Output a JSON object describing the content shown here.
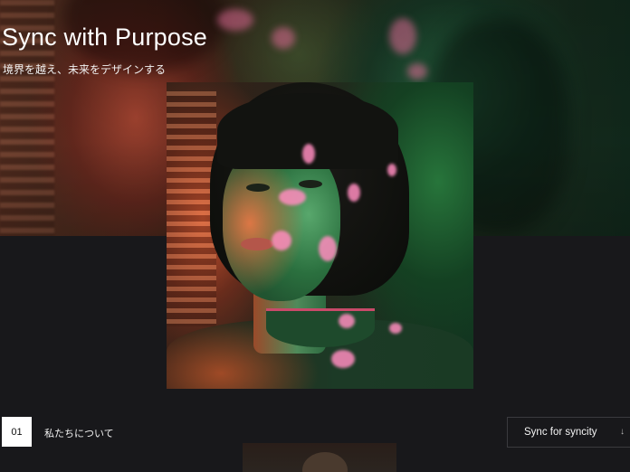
{
  "hero": {
    "title": "Sync with Purpose",
    "subtitle": "境界を越え、未来をデザインする"
  },
  "section": {
    "number": "01",
    "label": "私たちについて"
  },
  "cta": {
    "label": "Sync for syncity",
    "icon": "arrow-down-icon",
    "arrow": "↓"
  },
  "colors": {
    "background": "#18181b",
    "text": "#ffffff",
    "badge_bg": "#ffffff",
    "badge_text": "#111111"
  }
}
